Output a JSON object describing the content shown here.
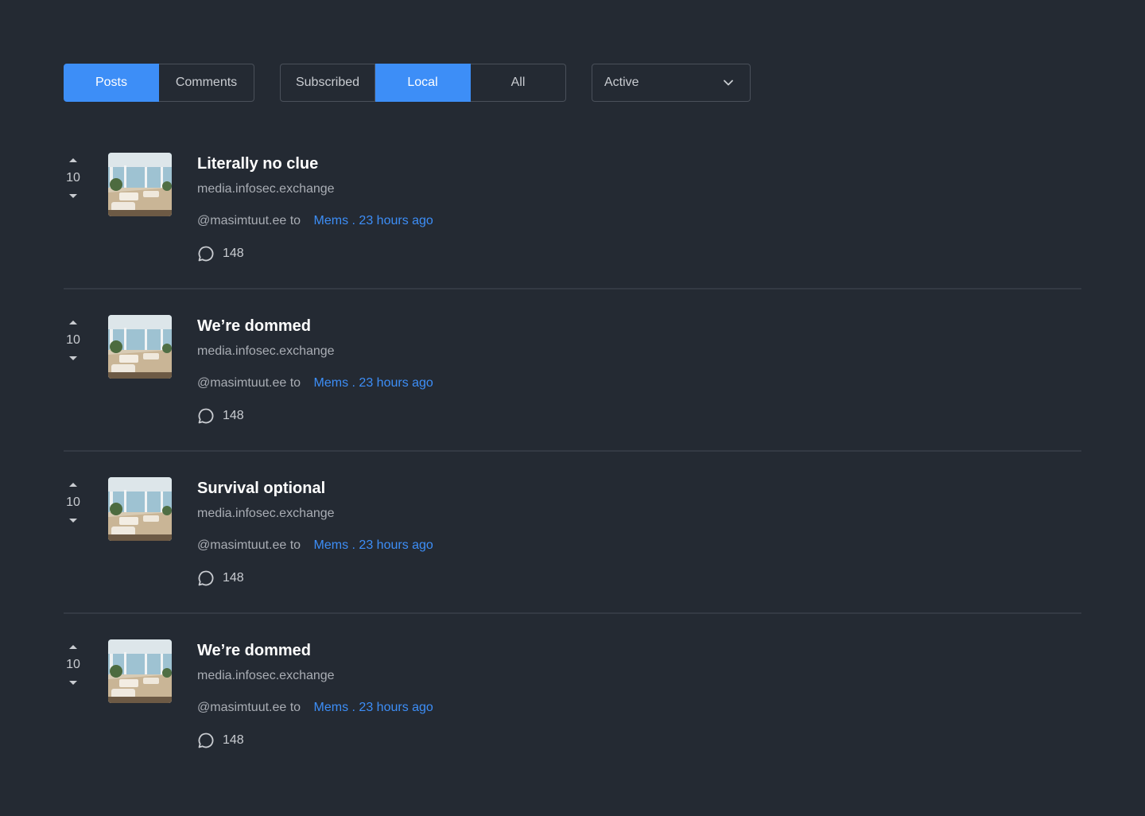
{
  "filters": {
    "type_tabs": [
      {
        "label": "Posts",
        "active": true
      },
      {
        "label": "Comments",
        "active": false
      }
    ],
    "listing_tabs": [
      {
        "label": "Subscribed",
        "active": false
      },
      {
        "label": "Local",
        "active": true
      },
      {
        "label": "All",
        "active": false
      }
    ],
    "sort": {
      "selected": "Active",
      "icon": "chevron-down-icon"
    }
  },
  "colors": {
    "background": "#242a33",
    "accent": "#3d8ef7",
    "divider": "#343a44"
  },
  "posts": [
    {
      "score": "10",
      "title": "Literally no clue",
      "domain": "media.infosec.exchange",
      "author": "@masimtuut.ee to",
      "community": "Mems . 23 hours ago",
      "comments": "148"
    },
    {
      "score": "10",
      "title": "We’re dommed",
      "domain": "media.infosec.exchange",
      "author": "@masimtuut.ee to",
      "community": "Mems . 23 hours ago",
      "comments": "148"
    },
    {
      "score": "10",
      "title": "Survival optional",
      "domain": "media.infosec.exchange",
      "author": "@masimtuut.ee to",
      "community": "Mems . 23 hours ago",
      "comments": "148"
    },
    {
      "score": "10",
      "title": "We’re dommed",
      "domain": "media.infosec.exchange",
      "author": "@masimtuut.ee to",
      "community": "Mems . 23 hours ago",
      "comments": "148"
    }
  ]
}
